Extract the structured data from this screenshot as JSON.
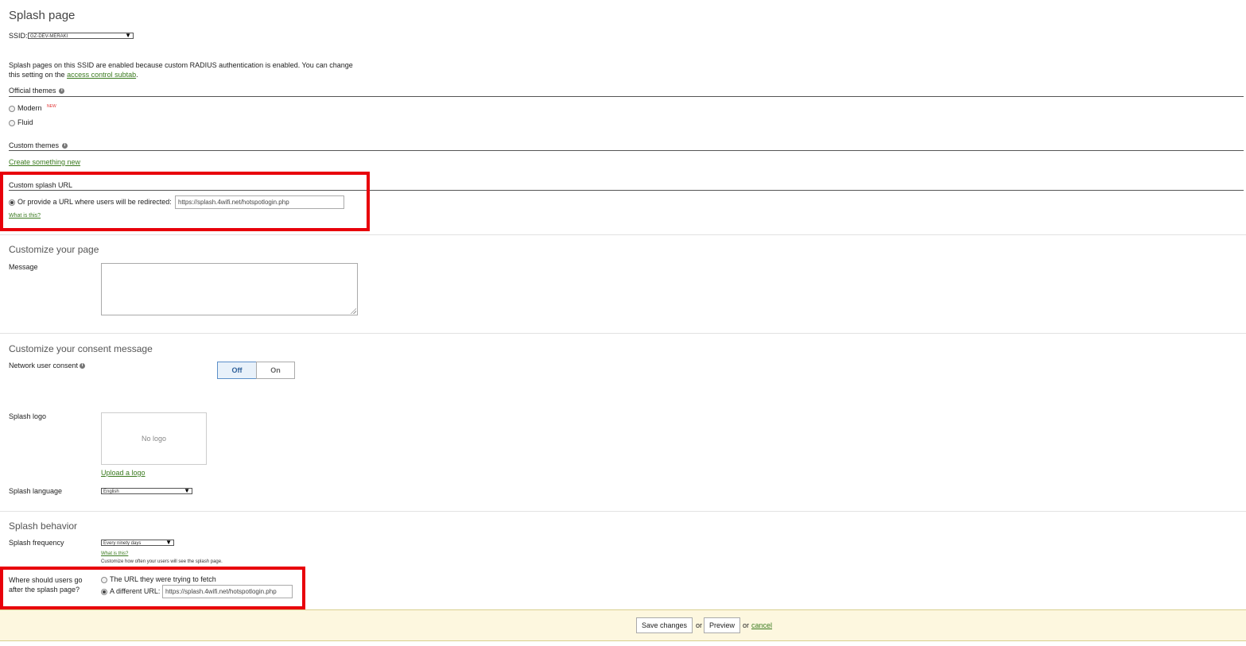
{
  "page": {
    "title": "Splash page"
  },
  "ssid": {
    "label": "SSID:",
    "selected": "GZ-DEV-MERAKI"
  },
  "notice": {
    "line1": "Splash pages on this SSID are enabled because custom RADIUS authentication is enabled. You can change",
    "line2_prefix": "this setting on the",
    "link": "access control subtab",
    "line2_suffix": "."
  },
  "official_themes": {
    "title": "Official themes",
    "options": [
      {
        "label": "Modern",
        "badge": "NEW",
        "selected": false
      },
      {
        "label": "Fluid",
        "selected": false
      }
    ]
  },
  "custom_themes": {
    "title": "Custom themes",
    "create_link": "Create something new"
  },
  "custom_splash_url": {
    "title": "Custom splash URL",
    "option_label": "Or provide a URL where users will be redirected:",
    "url_value": "https://splash.4wifi.net/hotspotlogin.php",
    "what_link": "What is this?"
  },
  "customize_page": {
    "title": "Customize your page",
    "message_label": "Message",
    "message_value": ""
  },
  "consent": {
    "title": "Customize your consent message",
    "label": "Network user consent",
    "off_label": "Off",
    "on_label": "On",
    "state": "Off"
  },
  "logo": {
    "label": "Splash logo",
    "placeholder": "No logo",
    "upload_link": "Upload a logo"
  },
  "language": {
    "label": "Splash language",
    "selected": "English"
  },
  "behavior": {
    "title": "Splash behavior",
    "frequency_label": "Splash frequency",
    "frequency_selected": "Every ninety days",
    "what_link": "What is this?",
    "frequency_hint": "Customize how often your users will see the splash page.",
    "redirect_label_1": "Where should users go",
    "redirect_label_2": "after the splash page?",
    "option_fetch": "The URL they were trying to fetch",
    "option_different": "A different URL:",
    "different_url_value": "https://splash.4wifi.net/hotspotlogin.php"
  },
  "footer": {
    "save_label": "Save changes",
    "or1": "or",
    "preview_label": "Preview",
    "or2": "or",
    "cancel_label": "cancel"
  },
  "colors": {
    "accent_link": "#3a7a1f",
    "highlight_box": "#e8000b",
    "footer_bg": "#fdf7df"
  }
}
